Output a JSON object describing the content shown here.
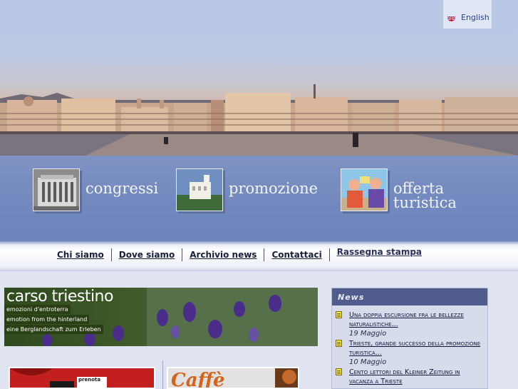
{
  "language": {
    "label": "English",
    "flag_icon": "uk-flag-icon"
  },
  "sections": [
    {
      "label": "congressi",
      "icon": "theater-building-icon"
    },
    {
      "label": "promozione",
      "icon": "castle-icon"
    },
    {
      "label": "offerta\nturistica",
      "icon": "tourists-illustration-icon"
    }
  ],
  "nav": {
    "items": [
      "Chi siamo",
      "Dove siamo",
      "Archivio news",
      "Contattaci",
      "Rassegna stampa"
    ]
  },
  "carso": {
    "title": "carso triestino",
    "tags": [
      "emozioni d'entroterra",
      "emotion from the hinterland",
      "eine Berglandschaft zum Erleben"
    ]
  },
  "news": {
    "header": "News",
    "items": [
      {
        "title": "Una doppia escursione fra le bellezze naturalistiche...",
        "date": "19 Maggio"
      },
      {
        "title": "Trieste, grande successo della promozione turistica...",
        "date": "10 Maggio"
      },
      {
        "title": "Cento lettori del Kleiner Zeitung in vacanza a Trieste",
        "date": ""
      }
    ]
  },
  "banners": {
    "teatro_text": "prenota",
    "caffe_text": "Caffè"
  },
  "colors": {
    "section_band": "#7088be",
    "news_header": "#4f5c8c",
    "link": "#2a3f8a"
  }
}
